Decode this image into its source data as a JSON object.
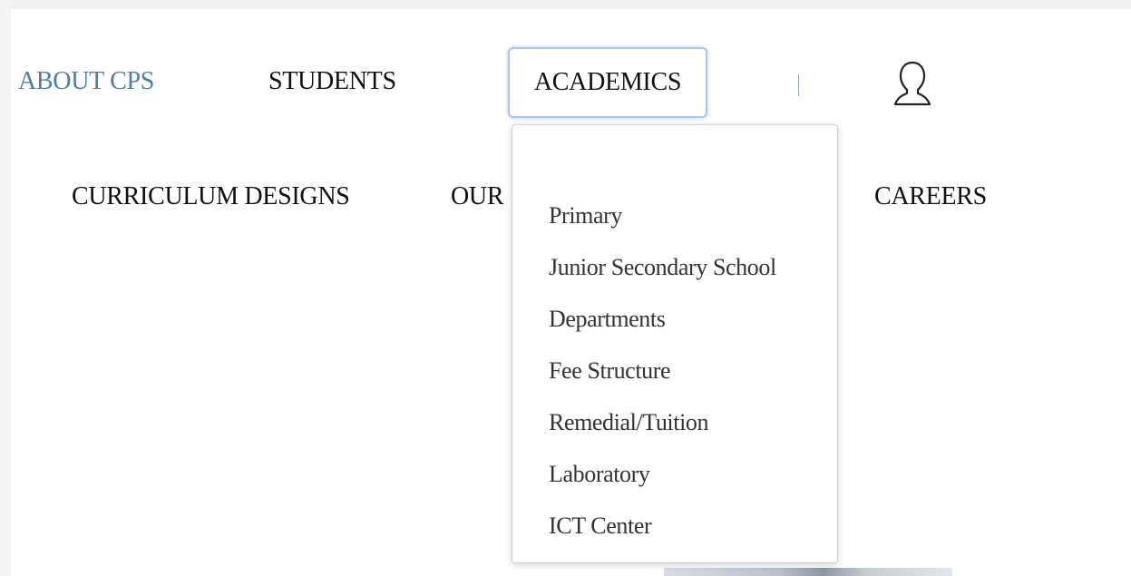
{
  "nav": {
    "row1": {
      "about": "ABOUT CPS",
      "students": "STUDENTS",
      "academics": "ACADEMICS"
    },
    "row2": {
      "curriculum": "CURRICULUM DESIGNS",
      "our_partial": "OUR",
      "careers": "CAREERS"
    },
    "account_icon": "user-icon"
  },
  "academics_menu": {
    "items": [
      {
        "label": "Primary"
      },
      {
        "label": "Junior Secondary School"
      },
      {
        "label": "Departments"
      },
      {
        "label": "Fee Structure"
      },
      {
        "label": "Remedial/Tuition"
      },
      {
        "label": "Laboratory"
      },
      {
        "label": "ICT Center"
      }
    ]
  },
  "colors": {
    "active_link": "#4a7fb5",
    "focus_ring": "#a9c7ee",
    "text": "#111111",
    "menu_text": "#333333"
  }
}
